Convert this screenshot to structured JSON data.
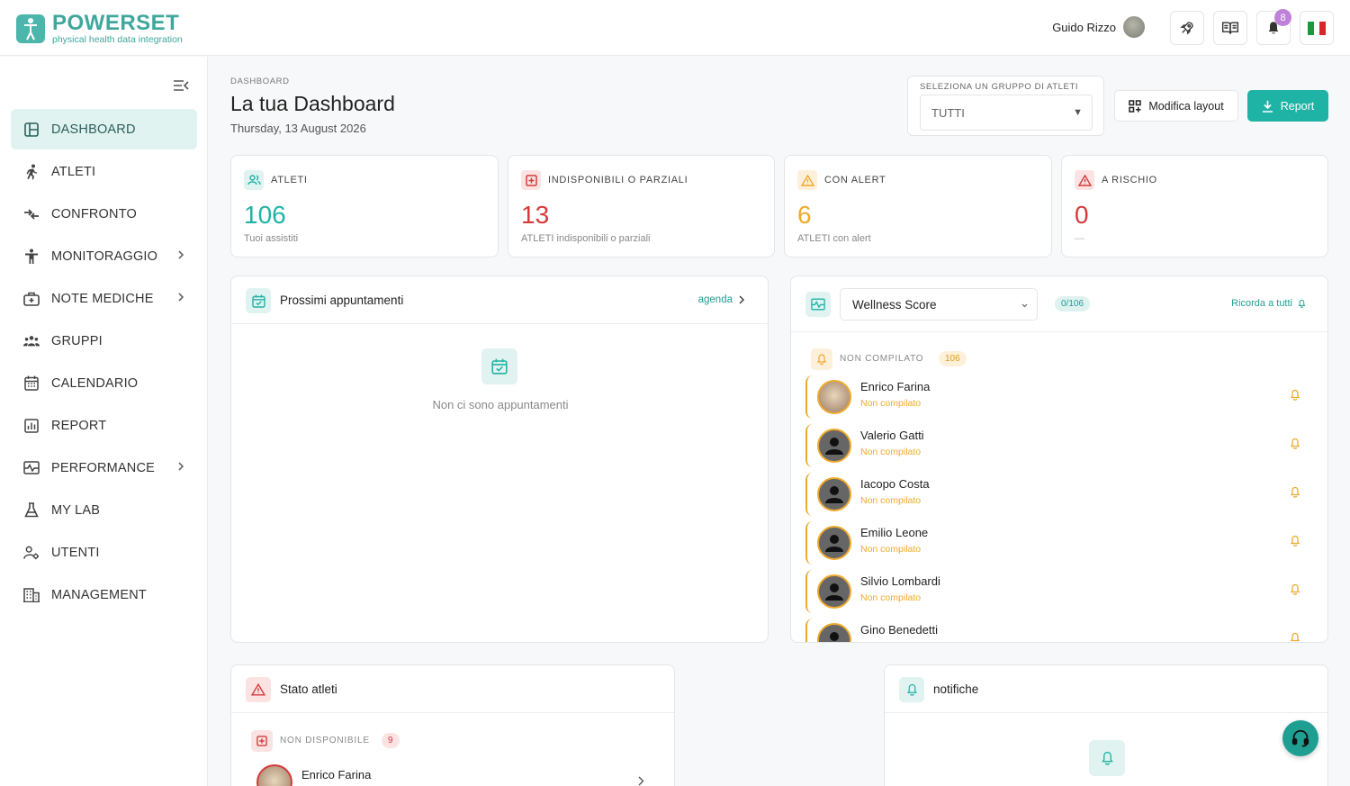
{
  "brand": {
    "name": "POWERSET",
    "tagline": "physical health data integration"
  },
  "topbar": {
    "user_name": "Guido Rizzo",
    "notification_count": "8"
  },
  "sidebar": {
    "items": [
      {
        "label": "DASHBOARD",
        "icon": "layout-icon",
        "active": true
      },
      {
        "label": "ATLETI",
        "icon": "runner-icon"
      },
      {
        "label": "CONFRONTO",
        "icon": "compare-arrows-icon"
      },
      {
        "label": "MONITORAGGIO",
        "icon": "person-icon",
        "has_children": true
      },
      {
        "label": "NOTE MEDICHE",
        "icon": "medical-bag-icon",
        "has_children": true
      },
      {
        "label": "GRUPPI",
        "icon": "group-icon"
      },
      {
        "label": "CALENDARIO",
        "icon": "calendar-icon"
      },
      {
        "label": "REPORT",
        "icon": "bar-chart-icon"
      },
      {
        "label": "PERFORMANCE",
        "icon": "performance-icon",
        "has_children": true
      },
      {
        "label": "MY LAB",
        "icon": "flask-icon"
      },
      {
        "label": "UTENTI",
        "icon": "user-gear-icon"
      },
      {
        "label": "MANAGEMENT",
        "icon": "building-icon"
      }
    ]
  },
  "header": {
    "breadcrumb": "DASHBOARD",
    "title": "La tua Dashboard",
    "date": "Thursday, 13 August 2026",
    "group_label": "SELEZIONA UN GRUPPO DI ATLETI",
    "group_value": "TUTTI",
    "layout_button": "Modifica layout",
    "report_button": "Report"
  },
  "stats": [
    {
      "label": "ATLETI",
      "value": "106",
      "sub": "Tuoi assistiti",
      "color": "#1fb3a5"
    },
    {
      "label": "INDISPONIBILI O PARZIALI",
      "value": "13",
      "sub": "ATLETI indisponibili o parziali",
      "color": "#d63a3a"
    },
    {
      "label": "CON ALERT",
      "value": "6",
      "sub": "ATLETI con alert",
      "color": "#f0a92c"
    },
    {
      "label": "A RISCHIO",
      "value": "0",
      "sub": "—",
      "color": "#d63a3a"
    }
  ],
  "appointments": {
    "title": "Prossimi appuntamenti",
    "link": "agenda",
    "empty": "Non ci sono appuntamenti"
  },
  "wellness": {
    "select_value": "Wellness Score",
    "progress": "0/106",
    "remind_all": "Ricorda a tutti",
    "section_label": "NON COMPILATO",
    "section_count": "106",
    "people": [
      {
        "name": "Enrico Farina",
        "status": "Non compilato",
        "photo": true
      },
      {
        "name": "Valerio Gatti",
        "status": "Non compilato"
      },
      {
        "name": "Iacopo Costa",
        "status": "Non compilato"
      },
      {
        "name": "Emilio Leone",
        "status": "Non compilato"
      },
      {
        "name": "Silvio Lombardi",
        "status": "Non compilato"
      },
      {
        "name": "Gino Benedetti",
        "status": ""
      }
    ]
  },
  "athlete_status": {
    "title": "Stato atleti",
    "section_label": "NON DISPONIBILE",
    "section_count": "9",
    "first_person": "Enrico Farina"
  },
  "notifications": {
    "title": "notifiche"
  }
}
